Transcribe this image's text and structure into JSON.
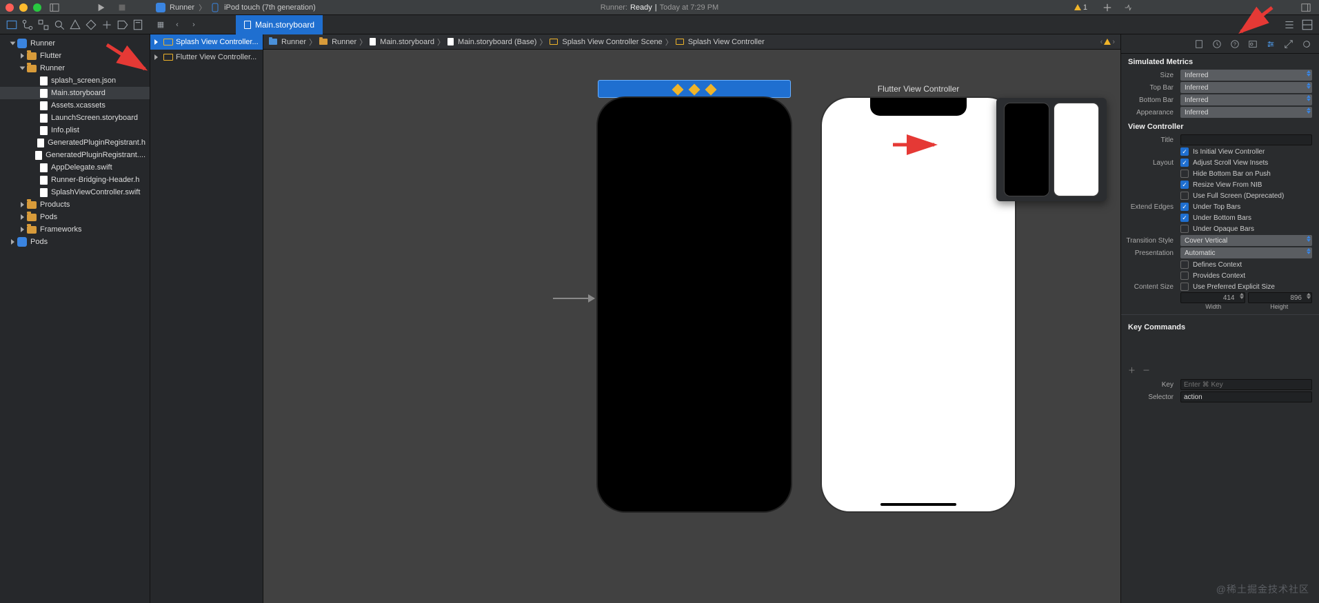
{
  "titlebar": {
    "scheme_app": "Runner",
    "scheme_device": "iPod touch (7th generation)",
    "status_app": "Runner:",
    "status_state": "Ready",
    "status_time": "Today at 7:29 PM",
    "warn_count": "1"
  },
  "file_tab": {
    "name": "Main.storyboard"
  },
  "sidebar": {
    "root": "Runner",
    "flutter": "Flutter",
    "runner_group": "Runner",
    "files": {
      "splash_json": "splash_screen.json",
      "main_sb": "Main.storyboard",
      "assets": "Assets.xcassets",
      "launch_sb": "LaunchScreen.storyboard",
      "info": "Info.plist",
      "gpr_h": "GeneratedPluginRegistrant.h",
      "gpr_m": "GeneratedPluginRegistrant....",
      "appdelegate": "AppDelegate.swift",
      "bridging": "Runner-Bridging-Header.h",
      "splash_vc": "SplashViewController.swift"
    },
    "products": "Products",
    "pods_group": "Pods",
    "frameworks": "Frameworks",
    "pods_proj": "Pods"
  },
  "outline": {
    "splash": "Splash View Controller...",
    "flutter": "Flutter View Controller..."
  },
  "breadcrumb": {
    "c0": "Runner",
    "c1": "Runner",
    "c2": "Main.storyboard",
    "c3": "Main.storyboard (Base)",
    "c4": "Splash View Controller Scene",
    "c5": "Splash View Controller"
  },
  "canvas": {
    "flutter_label": "Flutter View Controller"
  },
  "inspector": {
    "sim_metrics_h": "Simulated Metrics",
    "size_l": "Size",
    "size_v": "Inferred",
    "topbar_l": "Top Bar",
    "topbar_v": "Inferred",
    "botbar_l": "Bottom Bar",
    "botbar_v": "Inferred",
    "appear_l": "Appearance",
    "appear_v": "Inferred",
    "vc_h": "View Controller",
    "title_l": "Title",
    "initial_l": "Is Initial View Controller",
    "layout_l": "Layout",
    "adjust_l": "Adjust Scroll View Insets",
    "hidebot_l": "Hide Bottom Bar on Push",
    "resize_l": "Resize View From NIB",
    "full_l": "Use Full Screen (Deprecated)",
    "extend_l": "Extend Edges",
    "undertop_l": "Under Top Bars",
    "underbot_l": "Under Bottom Bars",
    "opaque_l": "Under Opaque Bars",
    "trans_l": "Transition Style",
    "trans_v": "Cover Vertical",
    "pres_l": "Presentation",
    "pres_v": "Automatic",
    "defctx_l": "Defines Context",
    "provctx_l": "Provides Context",
    "csize_l": "Content Size",
    "csize_pref": "Use Preferred Explicit Size",
    "width_v": "414",
    "height_v": "896",
    "width_l": "Width",
    "height_l": "Height",
    "keycmd_h": "Key Commands",
    "key_l": "Key",
    "key_ph": "Enter ⌘ Key",
    "sel_l": "Selector",
    "sel_v": "action"
  },
  "watermark": "@稀土掘金技术社区"
}
